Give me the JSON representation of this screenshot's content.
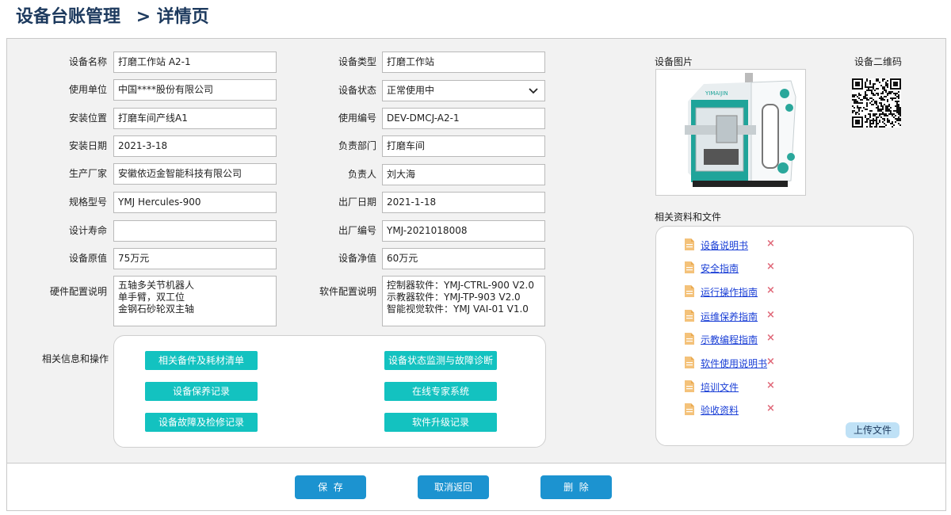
{
  "header": {
    "title": "设备台账管理",
    "separator": ">",
    "subtitle": "详情页"
  },
  "form": {
    "left": [
      {
        "label": "设备名称",
        "value": "打磨工作站 A2-1"
      },
      {
        "label": "使用单位",
        "value": "中国****股份有限公司"
      },
      {
        "label": "安装位置",
        "value": "打磨车间产线A1"
      },
      {
        "label": "安装日期",
        "value": "2021-3-18"
      },
      {
        "label": "生产厂家",
        "value": "安徽依迈金智能科技有限公司"
      },
      {
        "label": "规格型号",
        "value": "YMJ Hercules-900"
      },
      {
        "label": "设计寿命",
        "value": ""
      },
      {
        "label": "设备原值",
        "value": "75万元"
      }
    ],
    "right": [
      {
        "label": "设备类型",
        "value": "打磨工作站"
      },
      {
        "label": "设备状态",
        "value": "正常使用中",
        "type": "select"
      },
      {
        "label": "使用编号",
        "value": "DEV-DMCJ-A2-1"
      },
      {
        "label": "负责部门",
        "value": "打磨车间"
      },
      {
        "label": "负责人",
        "value": "刘大海"
      },
      {
        "label": "出厂日期",
        "value": "2021-1-18"
      },
      {
        "label": "出厂编号",
        "value": "YMJ-2021018008"
      },
      {
        "label": "设备净值",
        "value": "60万元"
      }
    ],
    "hardware": {
      "label": "硬件配置说明",
      "lines": [
        "五轴多关节机器人",
        "单手臂，双工位",
        "金钢石砂轮双主轴"
      ]
    },
    "software": {
      "label": "软件配置说明",
      "lines": [
        "控制器软件：YMJ-CTRL-900 V2.0",
        "示教器软件：YMJ-TP-903 V2.0",
        "智能视觉软件：YMJ VAI-01 V1.0"
      ]
    }
  },
  "related": {
    "label": "相关信息和操作",
    "buttons_left": [
      "相关备件及耗材清单",
      "设备保养记录",
      "设备故障及检修记录"
    ],
    "buttons_right": [
      "设备状态监测与故障诊断",
      "在线专家系统",
      "软件升级记录"
    ]
  },
  "device_image": {
    "label": "设备图片",
    "brand_text": "YIMAIJIN"
  },
  "qr": {
    "label": "设备二维码"
  },
  "files": {
    "label": "相关资料和文件",
    "items": [
      "设备说明书",
      "安全指南",
      "运行操作指南",
      "运维保养指南",
      "示教编程指南",
      "软件使用说明书",
      "培训文件",
      "验收资料"
    ],
    "delete_icon": "×",
    "upload_label": "上传文件"
  },
  "footer": {
    "save": "保  存",
    "cancel": "取消返回",
    "delete": "删  除"
  },
  "colors": {
    "teal": "#13c2c0",
    "blue": "#1c93d0",
    "title": "#1d3a5e",
    "link": "#1a3fd6",
    "delete": "#e06a7a"
  }
}
